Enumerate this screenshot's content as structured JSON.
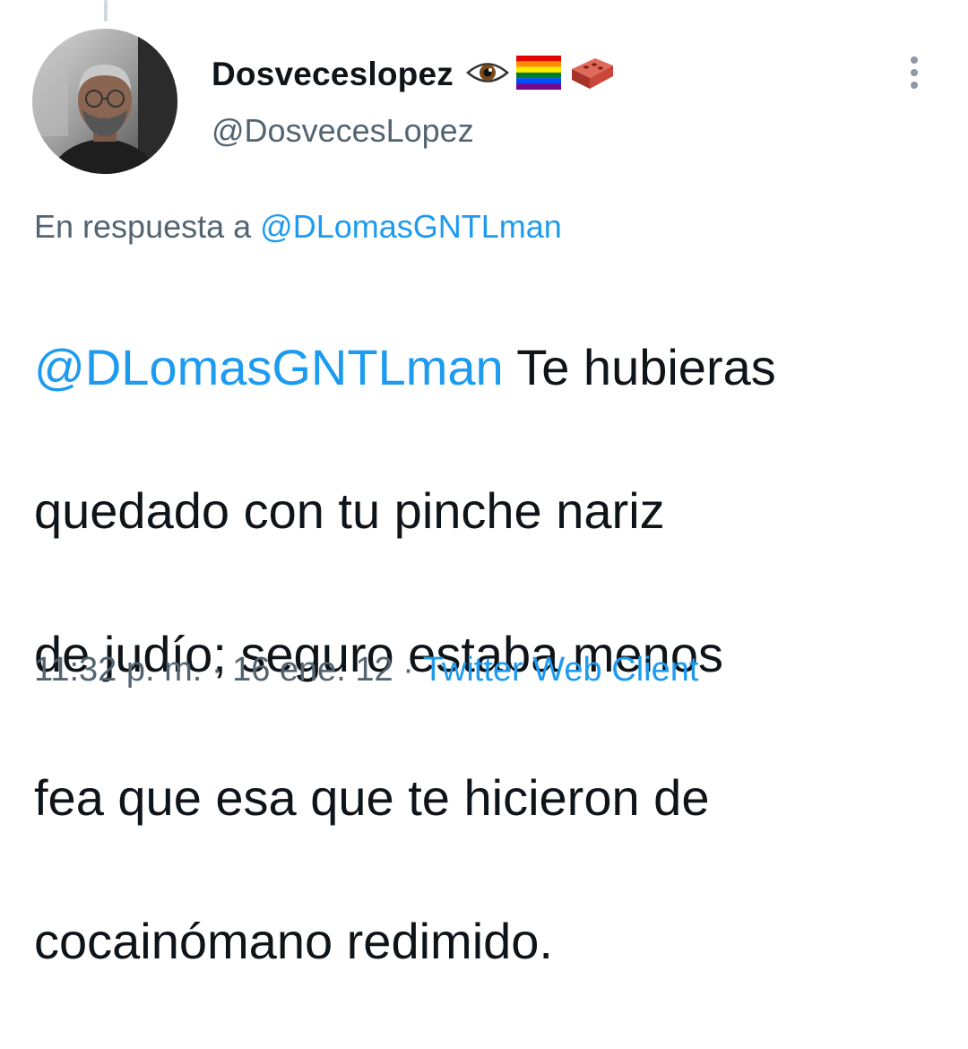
{
  "tweet": {
    "author": {
      "display_name": "Dosveceslopez",
      "emojis": [
        "eye-emoji",
        "rainbow-flag-emoji",
        "brick-emoji"
      ],
      "handle": "@DosvecesLopez"
    },
    "reply_to": {
      "prefix": "En respuesta a",
      "mention": "@DLomasGNTLman"
    },
    "text": {
      "mention": "@DLomasGNTLman",
      "line1_rest": " Te hubieras",
      "line2": "quedado con tu pinche nariz",
      "line3": "de judío; seguro estaba menos",
      "line4": "fea que esa que te hicieron de",
      "line5": "cocainómano redimido."
    },
    "meta": {
      "time": "11:32 p. m.",
      "sep1": " · ",
      "date": "16 ene. 12",
      "sep2": " · ",
      "client": "Twitter Web Client"
    },
    "more_icon": "more-vertical-icon"
  },
  "colors": {
    "text": "#0f1419",
    "secondary": "#536471",
    "link": "#1d9bf0",
    "thread_line": "#cfd9de"
  }
}
